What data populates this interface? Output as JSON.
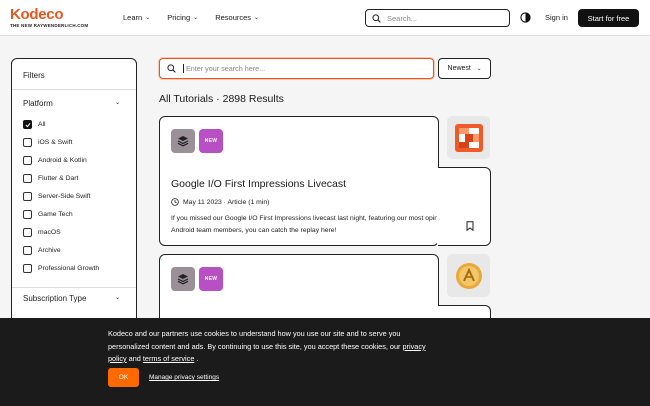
{
  "header": {
    "logo": "Kodeco",
    "logo_sub": "THE NEW RAYWENDERLICH.COM",
    "nav": [
      {
        "label": "Learn"
      },
      {
        "label": "Pricing"
      },
      {
        "label": "Resources"
      }
    ],
    "search_placeholder": "Search...",
    "signin": "Sign in",
    "start": "Start for free"
  },
  "sidebar": {
    "title": "Filters",
    "platform_title": "Platform",
    "platform_options": [
      {
        "label": "All",
        "checked": true
      },
      {
        "label": "iOS & Swift",
        "checked": false
      },
      {
        "label": "Android & Kotlin",
        "checked": false
      },
      {
        "label": "Flutter & Dart",
        "checked": false
      },
      {
        "label": "Server-Side Swift",
        "checked": false
      },
      {
        "label": "Game Tech",
        "checked": false
      },
      {
        "label": "macOS",
        "checked": false
      },
      {
        "label": "Archive",
        "checked": false
      },
      {
        "label": "Professional Growth",
        "checked": false
      }
    ],
    "subscription_title": "Subscription Type"
  },
  "main": {
    "search_placeholder": "Enter your search here...",
    "sort_label": "Newest",
    "results_heading": "All Tutorials · 2898 Results",
    "cards": [
      {
        "badge_new": "NEW",
        "title": "Google I/O First Impressions Livecast",
        "meta": "May 11 2023 · Article (1 min)",
        "desc": "If you missed our Google I/O First Impressions livecast last night, featuring our most opinionated Android team members, you can catch the replay here!"
      },
      {
        "badge_new": "NEW"
      }
    ]
  },
  "cookie": {
    "text_before": "Kodeco and our partners use cookies to understand how you use our site and to serve you personalized content and ads. By continuing to use this site, you accept these cookies, our ",
    "privacy_link": "privacy policy",
    "and": " and ",
    "terms_link": "terms of service",
    "period": " .",
    "ok": "OK",
    "manage": "Manage privacy settings"
  },
  "colors": {
    "brand_orange": "#e8561e",
    "new_badge": "#b84fc4",
    "ok_button": "#ff6a00"
  }
}
